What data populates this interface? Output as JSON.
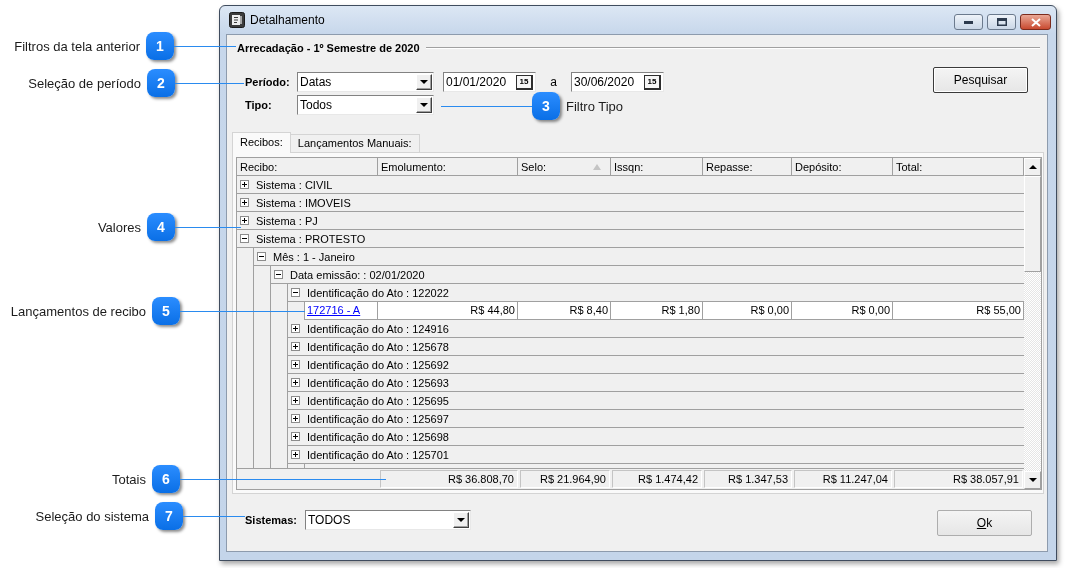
{
  "window": {
    "title": "Detalhamento"
  },
  "filter_group": {
    "title": "Arrecadação - 1º Semestre de 2020"
  },
  "filters": {
    "period": {
      "label": "Período:",
      "mode": "Datas",
      "start_date": {
        "value": "01/01/2020",
        "picker_label": "15"
      },
      "separator": "a",
      "end_date": {
        "value": "30/06/2020",
        "picker_label": "15"
      }
    },
    "type": {
      "label": "Tipo:",
      "value": "Todos"
    },
    "search_button": "Pesquisar"
  },
  "tabs": [
    {
      "label": "Recibos:",
      "selected": true
    },
    {
      "label": "Lançamentos Manuais:",
      "selected": false
    }
  ],
  "grid": {
    "columns": [
      {
        "label": "Recibo:",
        "sorted": false
      },
      {
        "label": "Emolumento:",
        "sorted": false
      },
      {
        "label": "Selo:",
        "sorted": true
      },
      {
        "label": "Issqn:",
        "sorted": false
      },
      {
        "label": "Repasse:",
        "sorted": false
      },
      {
        "label": "Depósito:",
        "sorted": false
      },
      {
        "label": "Total:",
        "sorted": false
      }
    ],
    "rows": [
      {
        "label": "Sistema : CIVIL",
        "expanded": false
      },
      {
        "label": "Sistema : IMOVEIS",
        "expanded": false
      },
      {
        "label": "Sistema : PJ",
        "expanded": false
      },
      {
        "label": "Sistema : PROTESTO",
        "expanded": true,
        "children": [
          {
            "label": "Mês : 1 - Janeiro",
            "expanded": true,
            "children": [
              {
                "label": "Data emissão: : 02/01/2020",
                "expanded": true,
                "children": [
                  {
                    "label": "Identificação do Ato : 122022",
                    "expanded": true,
                    "records": [
                      {
                        "receipt": "172716 - A",
                        "values": [
                          "R$ 44,80",
                          "R$ 8,40",
                          "R$ 1,80",
                          "R$ 0,00",
                          "R$ 0,00",
                          "R$ 55,00"
                        ]
                      }
                    ]
                  },
                  {
                    "label": "Identificação do Ato : 124916",
                    "expanded": false
                  },
                  {
                    "label": "Identificação do Ato : 125678",
                    "expanded": false
                  },
                  {
                    "label": "Identificação do Ato : 125692",
                    "expanded": false
                  },
                  {
                    "label": "Identificação do Ato : 125693",
                    "expanded": false
                  },
                  {
                    "label": "Identificação do Ato : 125695",
                    "expanded": false
                  },
                  {
                    "label": "Identificação do Ato : 125697",
                    "expanded": false
                  },
                  {
                    "label": "Identificação do Ato : 125698",
                    "expanded": false
                  },
                  {
                    "label": "Identificação do Ato : 125701",
                    "expanded": false
                  }
                ]
              }
            ]
          }
        ]
      }
    ],
    "totals": [
      "R$ 36.808,70",
      "R$ 21.964,90",
      "R$ 1.474,42",
      "R$ 1.347,53",
      "R$ 11.247,04",
      "R$ 38.057,91"
    ]
  },
  "system_filter": {
    "label": "Sistemas:",
    "value": "TODOS"
  },
  "ok_button": "Ok",
  "callouts": [
    {
      "number": "1",
      "label": "Filtros da tela anterior",
      "kind": "label-left"
    },
    {
      "number": "2",
      "label": "Seleção de período",
      "kind": "label-left"
    },
    {
      "number": "3",
      "label": "Filtro Tipo",
      "kind": "label-right"
    },
    {
      "number": "4",
      "label": "Valores",
      "kind": "label-left"
    },
    {
      "number": "5",
      "label": "Lançamentos de recibo",
      "kind": "label-left"
    },
    {
      "number": "6",
      "label": "Totais",
      "kind": "label-left"
    },
    {
      "number": "7",
      "label": "Seleção do sistema",
      "kind": "label-left"
    }
  ]
}
